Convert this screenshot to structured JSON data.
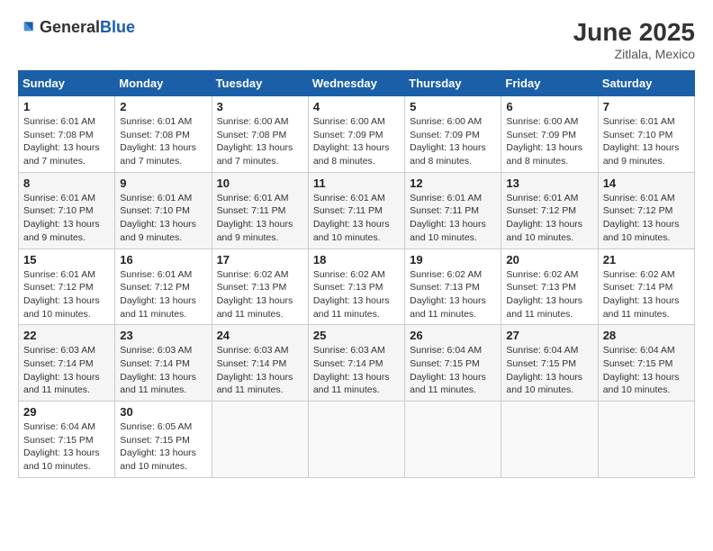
{
  "header": {
    "logo_general": "General",
    "logo_blue": "Blue",
    "month_year": "June 2025",
    "location": "Zitlala, Mexico"
  },
  "weekdays": [
    "Sunday",
    "Monday",
    "Tuesday",
    "Wednesday",
    "Thursday",
    "Friday",
    "Saturday"
  ],
  "weeks": [
    [
      {
        "day": "1",
        "sunrise": "6:01 AM",
        "sunset": "7:08 PM",
        "daylight": "13 hours and 7 minutes."
      },
      {
        "day": "2",
        "sunrise": "6:01 AM",
        "sunset": "7:08 PM",
        "daylight": "13 hours and 7 minutes."
      },
      {
        "day": "3",
        "sunrise": "6:00 AM",
        "sunset": "7:08 PM",
        "daylight": "13 hours and 7 minutes."
      },
      {
        "day": "4",
        "sunrise": "6:00 AM",
        "sunset": "7:09 PM",
        "daylight": "13 hours and 8 minutes."
      },
      {
        "day": "5",
        "sunrise": "6:00 AM",
        "sunset": "7:09 PM",
        "daylight": "13 hours and 8 minutes."
      },
      {
        "day": "6",
        "sunrise": "6:00 AM",
        "sunset": "7:09 PM",
        "daylight": "13 hours and 8 minutes."
      },
      {
        "day": "7",
        "sunrise": "6:01 AM",
        "sunset": "7:10 PM",
        "daylight": "13 hours and 9 minutes."
      }
    ],
    [
      {
        "day": "8",
        "sunrise": "6:01 AM",
        "sunset": "7:10 PM",
        "daylight": "13 hours and 9 minutes."
      },
      {
        "day": "9",
        "sunrise": "6:01 AM",
        "sunset": "7:10 PM",
        "daylight": "13 hours and 9 minutes."
      },
      {
        "day": "10",
        "sunrise": "6:01 AM",
        "sunset": "7:11 PM",
        "daylight": "13 hours and 9 minutes."
      },
      {
        "day": "11",
        "sunrise": "6:01 AM",
        "sunset": "7:11 PM",
        "daylight": "13 hours and 10 minutes."
      },
      {
        "day": "12",
        "sunrise": "6:01 AM",
        "sunset": "7:11 PM",
        "daylight": "13 hours and 10 minutes."
      },
      {
        "day": "13",
        "sunrise": "6:01 AM",
        "sunset": "7:12 PM",
        "daylight": "13 hours and 10 minutes."
      },
      {
        "day": "14",
        "sunrise": "6:01 AM",
        "sunset": "7:12 PM",
        "daylight": "13 hours and 10 minutes."
      }
    ],
    [
      {
        "day": "15",
        "sunrise": "6:01 AM",
        "sunset": "7:12 PM",
        "daylight": "13 hours and 10 minutes."
      },
      {
        "day": "16",
        "sunrise": "6:01 AM",
        "sunset": "7:12 PM",
        "daylight": "13 hours and 11 minutes."
      },
      {
        "day": "17",
        "sunrise": "6:02 AM",
        "sunset": "7:13 PM",
        "daylight": "13 hours and 11 minutes."
      },
      {
        "day": "18",
        "sunrise": "6:02 AM",
        "sunset": "7:13 PM",
        "daylight": "13 hours and 11 minutes."
      },
      {
        "day": "19",
        "sunrise": "6:02 AM",
        "sunset": "7:13 PM",
        "daylight": "13 hours and 11 minutes."
      },
      {
        "day": "20",
        "sunrise": "6:02 AM",
        "sunset": "7:13 PM",
        "daylight": "13 hours and 11 minutes."
      },
      {
        "day": "21",
        "sunrise": "6:02 AM",
        "sunset": "7:14 PM",
        "daylight": "13 hours and 11 minutes."
      }
    ],
    [
      {
        "day": "22",
        "sunrise": "6:03 AM",
        "sunset": "7:14 PM",
        "daylight": "13 hours and 11 minutes."
      },
      {
        "day": "23",
        "sunrise": "6:03 AM",
        "sunset": "7:14 PM",
        "daylight": "13 hours and 11 minutes."
      },
      {
        "day": "24",
        "sunrise": "6:03 AM",
        "sunset": "7:14 PM",
        "daylight": "13 hours and 11 minutes."
      },
      {
        "day": "25",
        "sunrise": "6:03 AM",
        "sunset": "7:14 PM",
        "daylight": "13 hours and 11 minutes."
      },
      {
        "day": "26",
        "sunrise": "6:04 AM",
        "sunset": "7:15 PM",
        "daylight": "13 hours and 11 minutes."
      },
      {
        "day": "27",
        "sunrise": "6:04 AM",
        "sunset": "7:15 PM",
        "daylight": "13 hours and 10 minutes."
      },
      {
        "day": "28",
        "sunrise": "6:04 AM",
        "sunset": "7:15 PM",
        "daylight": "13 hours and 10 minutes."
      }
    ],
    [
      {
        "day": "29",
        "sunrise": "6:04 AM",
        "sunset": "7:15 PM",
        "daylight": "13 hours and 10 minutes."
      },
      {
        "day": "30",
        "sunrise": "6:05 AM",
        "sunset": "7:15 PM",
        "daylight": "13 hours and 10 minutes."
      },
      null,
      null,
      null,
      null,
      null
    ]
  ]
}
